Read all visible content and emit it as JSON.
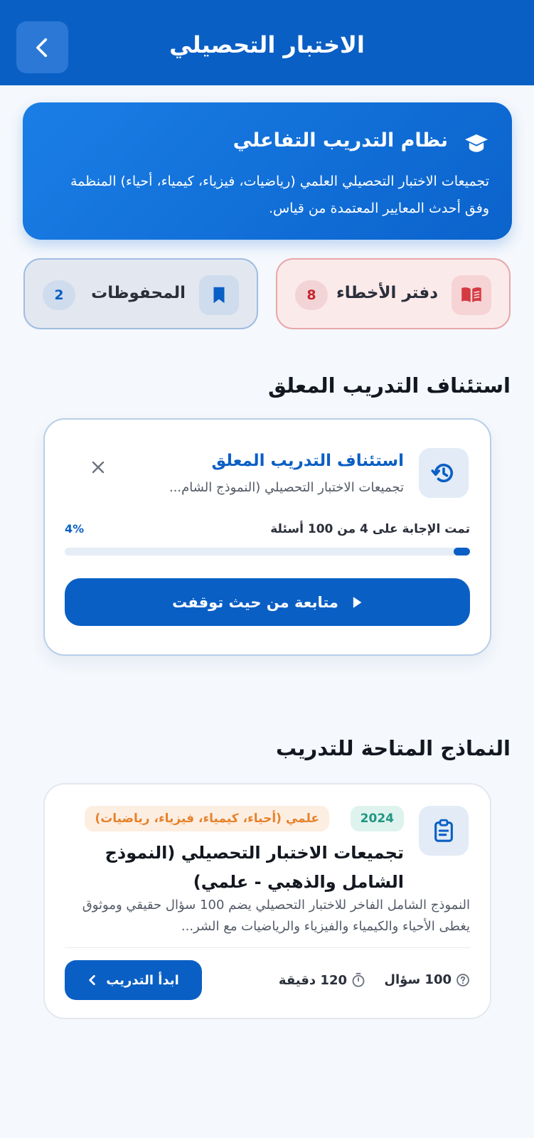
{
  "header": {
    "title": "الاختبار التحصيلي"
  },
  "hero": {
    "title": "نظام التدريب التفاعلي",
    "description": "تجميعات الاختبار التحصيلي العلمي (رياضيات، فيزياء، كيمياء، أحياء) المنظمة وفق أحدث المعايير المعتمدة من قياس."
  },
  "quick_cards": {
    "mistakes": {
      "label": "دفتر الأخطاء",
      "count": "8"
    },
    "saved": {
      "label": "المحفوظات",
      "count": "2"
    }
  },
  "resume_section": {
    "title": "استئناف التدريب المعلق"
  },
  "resume_card": {
    "title": "استئناف التدريب المعلق",
    "subtitle": "تجميعات الاختبار التحصيلي (النموذج الشام...",
    "progress_text": "تمت الإجابة على 4 من 100 أسئلة",
    "percent_label": "4%",
    "progress": 0.04,
    "continue_label": "متابعة من حيث توقفت"
  },
  "models_section": {
    "title": "النماذج المتاحة للتدريب"
  },
  "exam_card": {
    "year": "2024",
    "track": "علمي (أحياء، كيمياء، فيزياء، رياضيات)",
    "title": "تجميعات الاختبار التحصيلي (النموذج الشامل والذهبي - علمي)",
    "description": "النموذج الشامل الفاخر للاختبار التحصيلي يضم 100 سؤال حقيقي وموثوق يغطى الأحياء والكيمياء والفيزياء والرياضيات مع الشر...",
    "questions": "100 سؤال",
    "duration": "120 دقيقة",
    "start_label": "ابدأ التدريب"
  },
  "colors": {
    "primary": "#0a5fc4",
    "mistakes_accent": "#c6262e",
    "year_tag": "#1f9683",
    "track_tag": "#e6822b"
  }
}
